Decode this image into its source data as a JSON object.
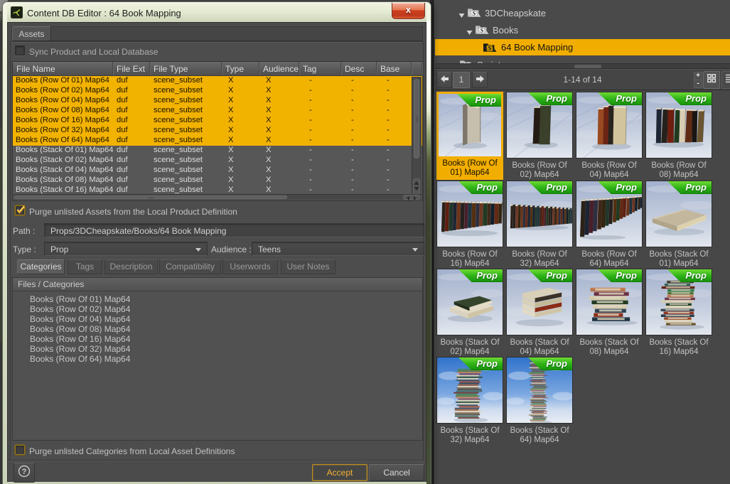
{
  "dialog": {
    "title": "Content DB Editor : 64 Book Mapping",
    "close_label": "x",
    "assets_tab": "Assets",
    "sync_checkbox_label": "Sync Product and Local Database",
    "table": {
      "columns": [
        "File Name",
        "File Ext",
        "File Type",
        "Type",
        "Audience",
        "Tag",
        "Desc",
        "Base"
      ],
      "rows": [
        {
          "file_name": "Books (Row Of 01) Map64",
          "file_ext": "duf",
          "file_type": "scene_subset",
          "type": "X",
          "audience": "X",
          "tag": "-",
          "desc": "-",
          "base": "-",
          "selected": true
        },
        {
          "file_name": "Books (Row Of 02) Map64",
          "file_ext": "duf",
          "file_type": "scene_subset",
          "type": "X",
          "audience": "X",
          "tag": "-",
          "desc": "-",
          "base": "-",
          "selected": true
        },
        {
          "file_name": "Books (Row Of 04) Map64",
          "file_ext": "duf",
          "file_type": "scene_subset",
          "type": "X",
          "audience": "X",
          "tag": "-",
          "desc": "-",
          "base": "-",
          "selected": true
        },
        {
          "file_name": "Books (Row Of 08) Map64",
          "file_ext": "duf",
          "file_type": "scene_subset",
          "type": "X",
          "audience": "X",
          "tag": "-",
          "desc": "-",
          "base": "-",
          "selected": true
        },
        {
          "file_name": "Books (Row Of 16) Map64",
          "file_ext": "duf",
          "file_type": "scene_subset",
          "type": "X",
          "audience": "X",
          "tag": "-",
          "desc": "-",
          "base": "-",
          "selected": true
        },
        {
          "file_name": "Books (Row Of 32) Map64",
          "file_ext": "duf",
          "file_type": "scene_subset",
          "type": "X",
          "audience": "X",
          "tag": "-",
          "desc": "-",
          "base": "-",
          "selected": true
        },
        {
          "file_name": "Books (Row Of 64) Map64",
          "file_ext": "duf",
          "file_type": "scene_subset",
          "type": "X",
          "audience": "X",
          "tag": "-",
          "desc": "-",
          "base": "-",
          "selected": true
        },
        {
          "file_name": "Books (Stack Of 01) Map64",
          "file_ext": "duf",
          "file_type": "scene_subset",
          "type": "X",
          "audience": "X",
          "tag": "-",
          "desc": "-",
          "base": "-",
          "selected": false
        },
        {
          "file_name": "Books (Stack Of 02) Map64",
          "file_ext": "duf",
          "file_type": "scene_subset",
          "type": "X",
          "audience": "X",
          "tag": "-",
          "desc": "-",
          "base": "-",
          "selected": false
        },
        {
          "file_name": "Books (Stack Of 04) Map64",
          "file_ext": "duf",
          "file_type": "scene_subset",
          "type": "X",
          "audience": "X",
          "tag": "-",
          "desc": "-",
          "base": "-",
          "selected": false
        },
        {
          "file_name": "Books (Stack Of 08) Map64",
          "file_ext": "duf",
          "file_type": "scene_subset",
          "type": "X",
          "audience": "X",
          "tag": "-",
          "desc": "-",
          "base": "-",
          "selected": false
        },
        {
          "file_name": "Books (Stack Of 16) Map64",
          "file_ext": "duf",
          "file_type": "scene_subset",
          "type": "X",
          "audience": "X",
          "tag": "-",
          "desc": "-",
          "base": "-",
          "selected": false
        }
      ]
    },
    "purge_assets_label": "Purge unlisted Assets from the Local Product Definition",
    "path_label": "Path :",
    "path_value": "Props/3DCheapskate/Books/64 Book Mapping",
    "type_label": "Type :",
    "type_value": "Prop",
    "audience_label": "Audience :",
    "audience_value": "Teens",
    "subtabs": [
      "Categories",
      "Tags",
      "Description",
      "Compatibility",
      "Userwords",
      "User Notes"
    ],
    "files_categories_header": "Files / Categories",
    "files_categories": [
      "Books (Row Of 01) Map64",
      "Books (Row Of 02) Map64",
      "Books (Row Of 04) Map64",
      "Books (Row Of 08) Map64",
      "Books (Row Of 16) Map64",
      "Books (Row Of 32) Map64",
      "Books (Row Of 64) Map64"
    ],
    "purge_categories_label": "Purge unlisted Categories from Local Asset Definitions",
    "help_label": "?",
    "accept_label": "Accept",
    "cancel_label": "Cancel"
  },
  "library": {
    "tree": [
      {
        "label": "3DCheapskate",
        "expanded": true
      },
      {
        "label": "Books",
        "expanded": true
      },
      {
        "label": "64 Book Mapping",
        "selected": true
      },
      {
        "label": "Scripts",
        "expanded": false
      }
    ],
    "pager": {
      "page": "1",
      "count_text": "1-14 of 14",
      "zoom_in": "+",
      "zoom_out": "-"
    },
    "items": [
      {
        "line1": "Books (Row Of",
        "line2": "01) Map64",
        "badge": "Prop",
        "selected": true
      },
      {
        "line1": "Books (Row Of",
        "line2": "02) Map64",
        "badge": "Prop",
        "selected": false
      },
      {
        "line1": "Books (Row Of",
        "line2": "04) Map64",
        "badge": "Prop",
        "selected": false
      },
      {
        "line1": "Books (Row Of",
        "line2": "08) Map64",
        "badge": "Prop",
        "selected": false
      },
      {
        "line1": "Books (Row Of",
        "line2": "16) Map64",
        "badge": "Prop",
        "selected": false
      },
      {
        "line1": "Books (Row Of",
        "line2": "32) Map64",
        "badge": "Prop",
        "selected": false
      },
      {
        "line1": "Books (Row Of",
        "line2": "64) Map64",
        "badge": "Prop",
        "selected": false
      },
      {
        "line1": "Books (Stack Of",
        "line2": "01) Map64",
        "badge": "Prop",
        "selected": false
      },
      {
        "line1": "Books (Stack Of",
        "line2": "02) Map64",
        "badge": "Prop",
        "selected": false
      },
      {
        "line1": "Books (Stack Of",
        "line2": "04) Map64",
        "badge": "Prop",
        "selected": false
      },
      {
        "line1": "Books (Stack Of",
        "line2": "08) Map64",
        "badge": "Prop",
        "selected": false
      },
      {
        "line1": "Books (Stack Of",
        "line2": "16) Map64",
        "badge": "Prop",
        "selected": false
      },
      {
        "line1": "Books (Stack Of",
        "line2": "32) Map64",
        "badge": "Prop",
        "selected": false
      },
      {
        "line1": "Books (Stack Of",
        "line2": "64) Map64",
        "badge": "Prop",
        "selected": false
      }
    ]
  },
  "colors": {
    "selection_orange": "#f2ae00",
    "badge_green": "#2fbf17",
    "close_red": "#c8411f"
  }
}
